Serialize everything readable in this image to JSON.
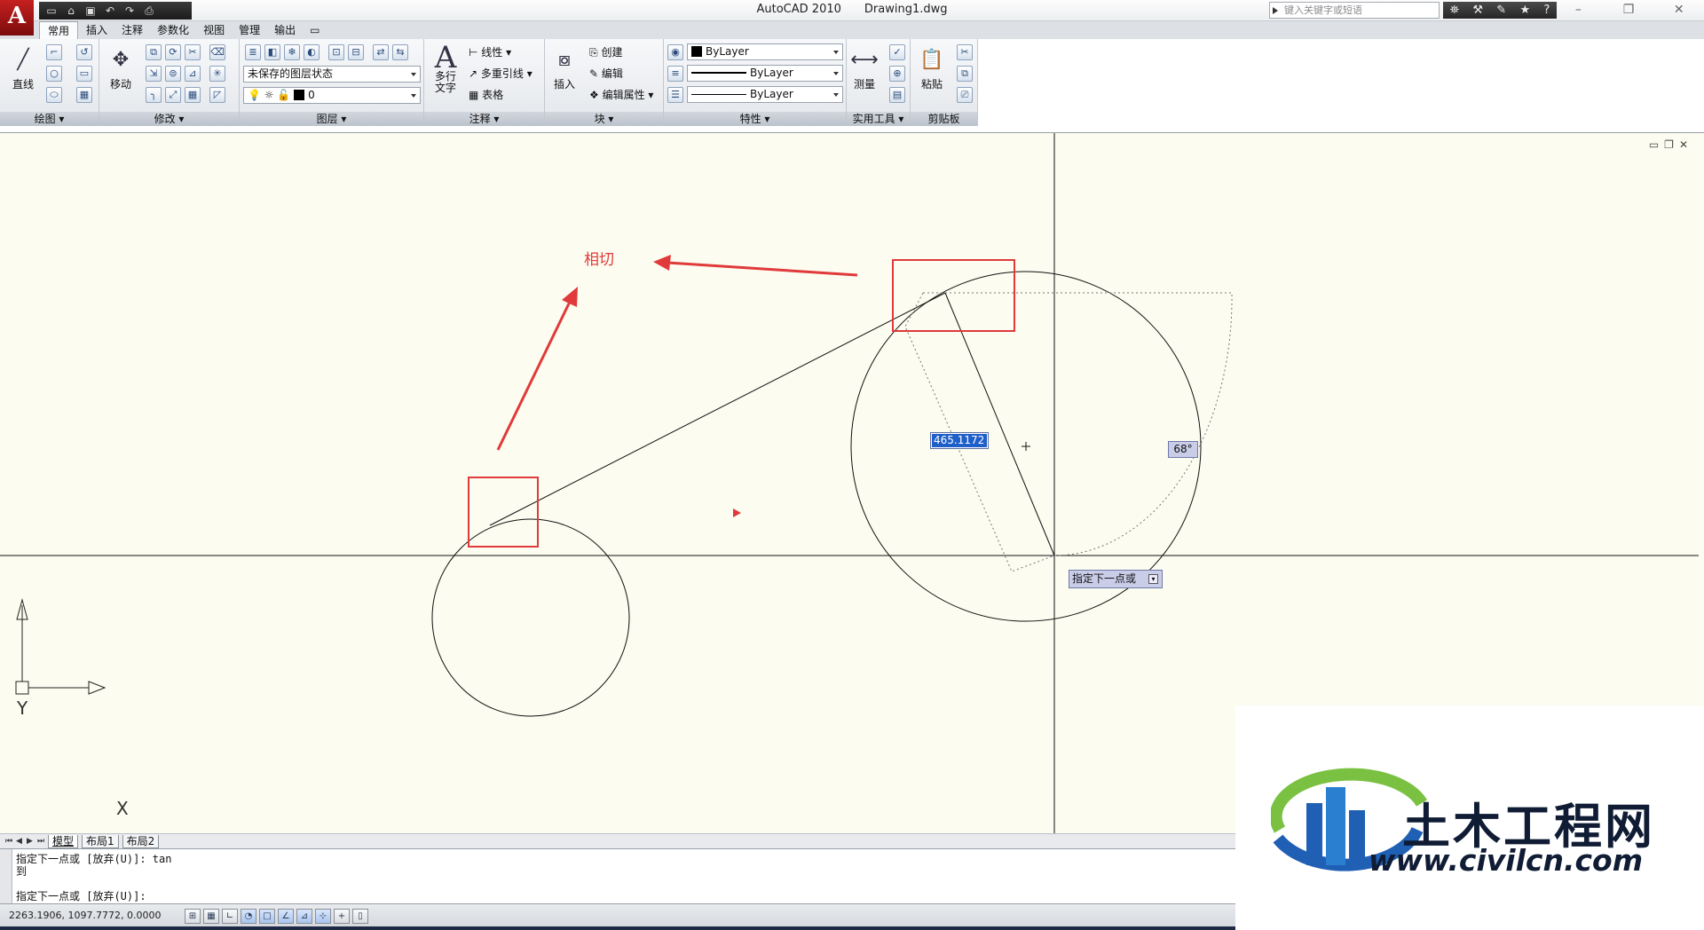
{
  "app": {
    "logo_letter": "A",
    "app_name": "AutoCAD 2010",
    "document": "Drawing1.dwg",
    "search_placeholder": "键入关键字或短语",
    "qat_icons": [
      "new-icon",
      "open-icon",
      "save-icon",
      "undo-icon",
      "redo-icon",
      "plot-icon"
    ]
  },
  "ribbon_tabs": [
    "常用",
    "插入",
    "注释",
    "参数化",
    "视图",
    "管理",
    "输出"
  ],
  "active_tab": "常用",
  "panels": {
    "draw": {
      "label": "绘图",
      "line": "直线"
    },
    "modify": {
      "label": "修改",
      "move": "移动"
    },
    "layer": {
      "label": "图层",
      "state": "未保存的图层状态",
      "current": "0"
    },
    "annotation": {
      "label": "注释",
      "mtext": "多行",
      "mtext2": "文字",
      "linear": "线性",
      "mleader": "多重引线",
      "table": "表格"
    },
    "block": {
      "label": "块",
      "insert": "插入",
      "create": "创建",
      "edit": "编辑",
      "attr": "编辑属性"
    },
    "properties": {
      "label": "特性",
      "color": "ByLayer",
      "linetype": "ByLayer",
      "lineweight": "ByLayer"
    },
    "utilities": {
      "label": "实用工具",
      "measure": "测量"
    },
    "clipboard": {
      "label": "剪贴板",
      "paste": "粘贴"
    }
  },
  "canvas": {
    "annotation_text": "相切",
    "distance_input": "465.1172",
    "angle_input": "68°",
    "tooltip": "指定下一点或",
    "ucs_x": "X",
    "ucs_y": "Y",
    "background": "#fdfcf0",
    "annotation_color": "#e03a3a"
  },
  "layout_tabs": [
    "模型",
    "布局1",
    "布局2"
  ],
  "command_lines": [
    "指定下一点或 [放弃(U)]: tan",
    "到",
    "指定下一点或 [放弃(U)]:"
  ],
  "status": {
    "coordinates": "2263.1906, 1097.7772, 0.0000"
  },
  "watermark": {
    "name": "土木工程网",
    "url": "www.civilcn.com"
  }
}
